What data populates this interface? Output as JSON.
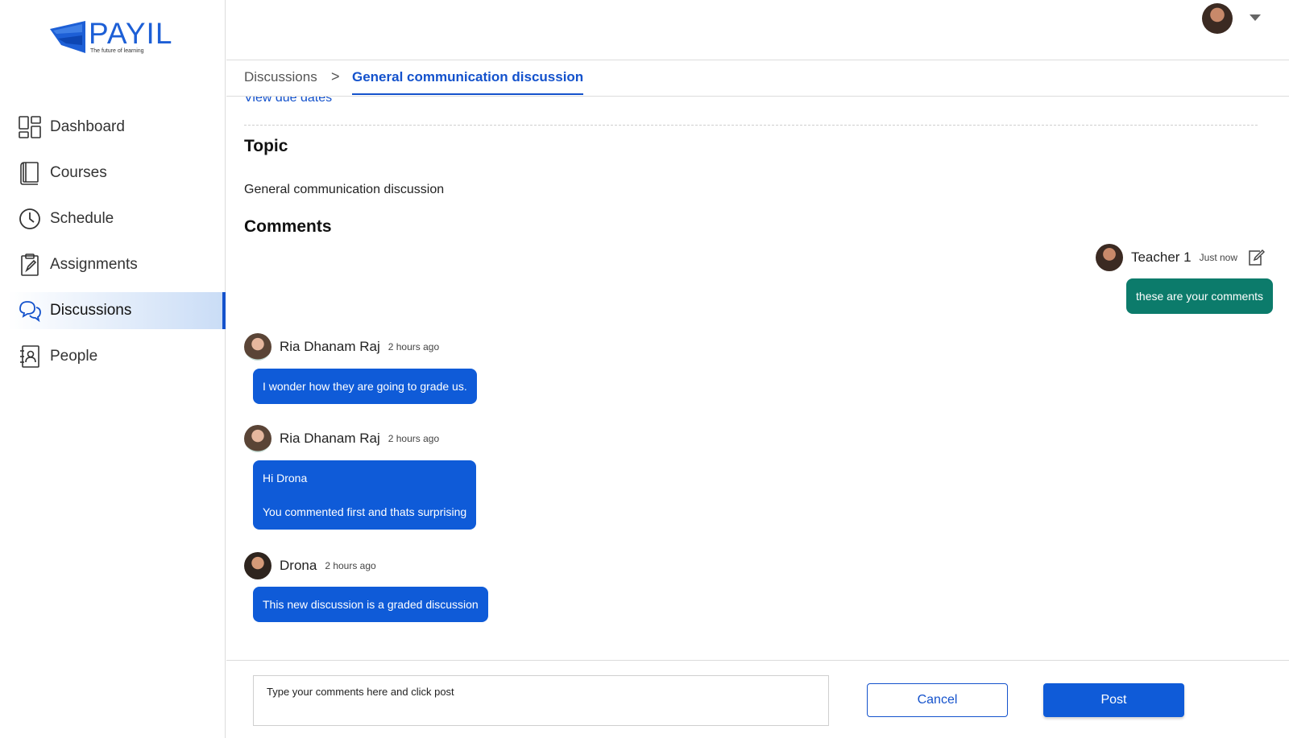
{
  "logo": {
    "text": "PAYIL",
    "tagline": "The future of learning"
  },
  "colors": {
    "brand": "#1452cc",
    "bubble_other": "#0f5bd8",
    "bubble_own": "#0c7b6b"
  },
  "sidebar": {
    "items": [
      {
        "label": "Dashboard",
        "icon": "dashboard-icon"
      },
      {
        "label": "Courses",
        "icon": "book-icon"
      },
      {
        "label": "Schedule",
        "icon": "clock-icon"
      },
      {
        "label": "Assignments",
        "icon": "clipboard-icon"
      },
      {
        "label": "Discussions",
        "icon": "chat-bubbles-icon",
        "active": true
      },
      {
        "label": "People",
        "icon": "contact-book-icon"
      }
    ]
  },
  "breadcrumb": {
    "parent": "Discussions",
    "separator": ">",
    "current": "General communication discussion"
  },
  "main": {
    "due_link": "View due dates",
    "topic_heading": "Topic",
    "topic_text": "General communication discussion",
    "comments_heading": "Comments"
  },
  "comments": [
    {
      "author": "Teacher 1",
      "time": "Just now",
      "lines": [
        "these are your comments"
      ],
      "own": true
    },
    {
      "author": "Ria Dhanam Raj",
      "time": "2 hours ago",
      "lines": [
        "I wonder how they are going to grade us."
      ]
    },
    {
      "author": "Ria Dhanam Raj",
      "time": "2 hours ago",
      "lines": [
        "Hi Drona",
        "You commented first and thats surprising"
      ]
    },
    {
      "author": "Drona",
      "time": "2 hours ago",
      "lines": [
        "This new discussion is a graded discussion"
      ]
    }
  ],
  "footer": {
    "input_value": "Type your comments here and click post",
    "cancel_label": "Cancel",
    "post_label": "Post"
  }
}
